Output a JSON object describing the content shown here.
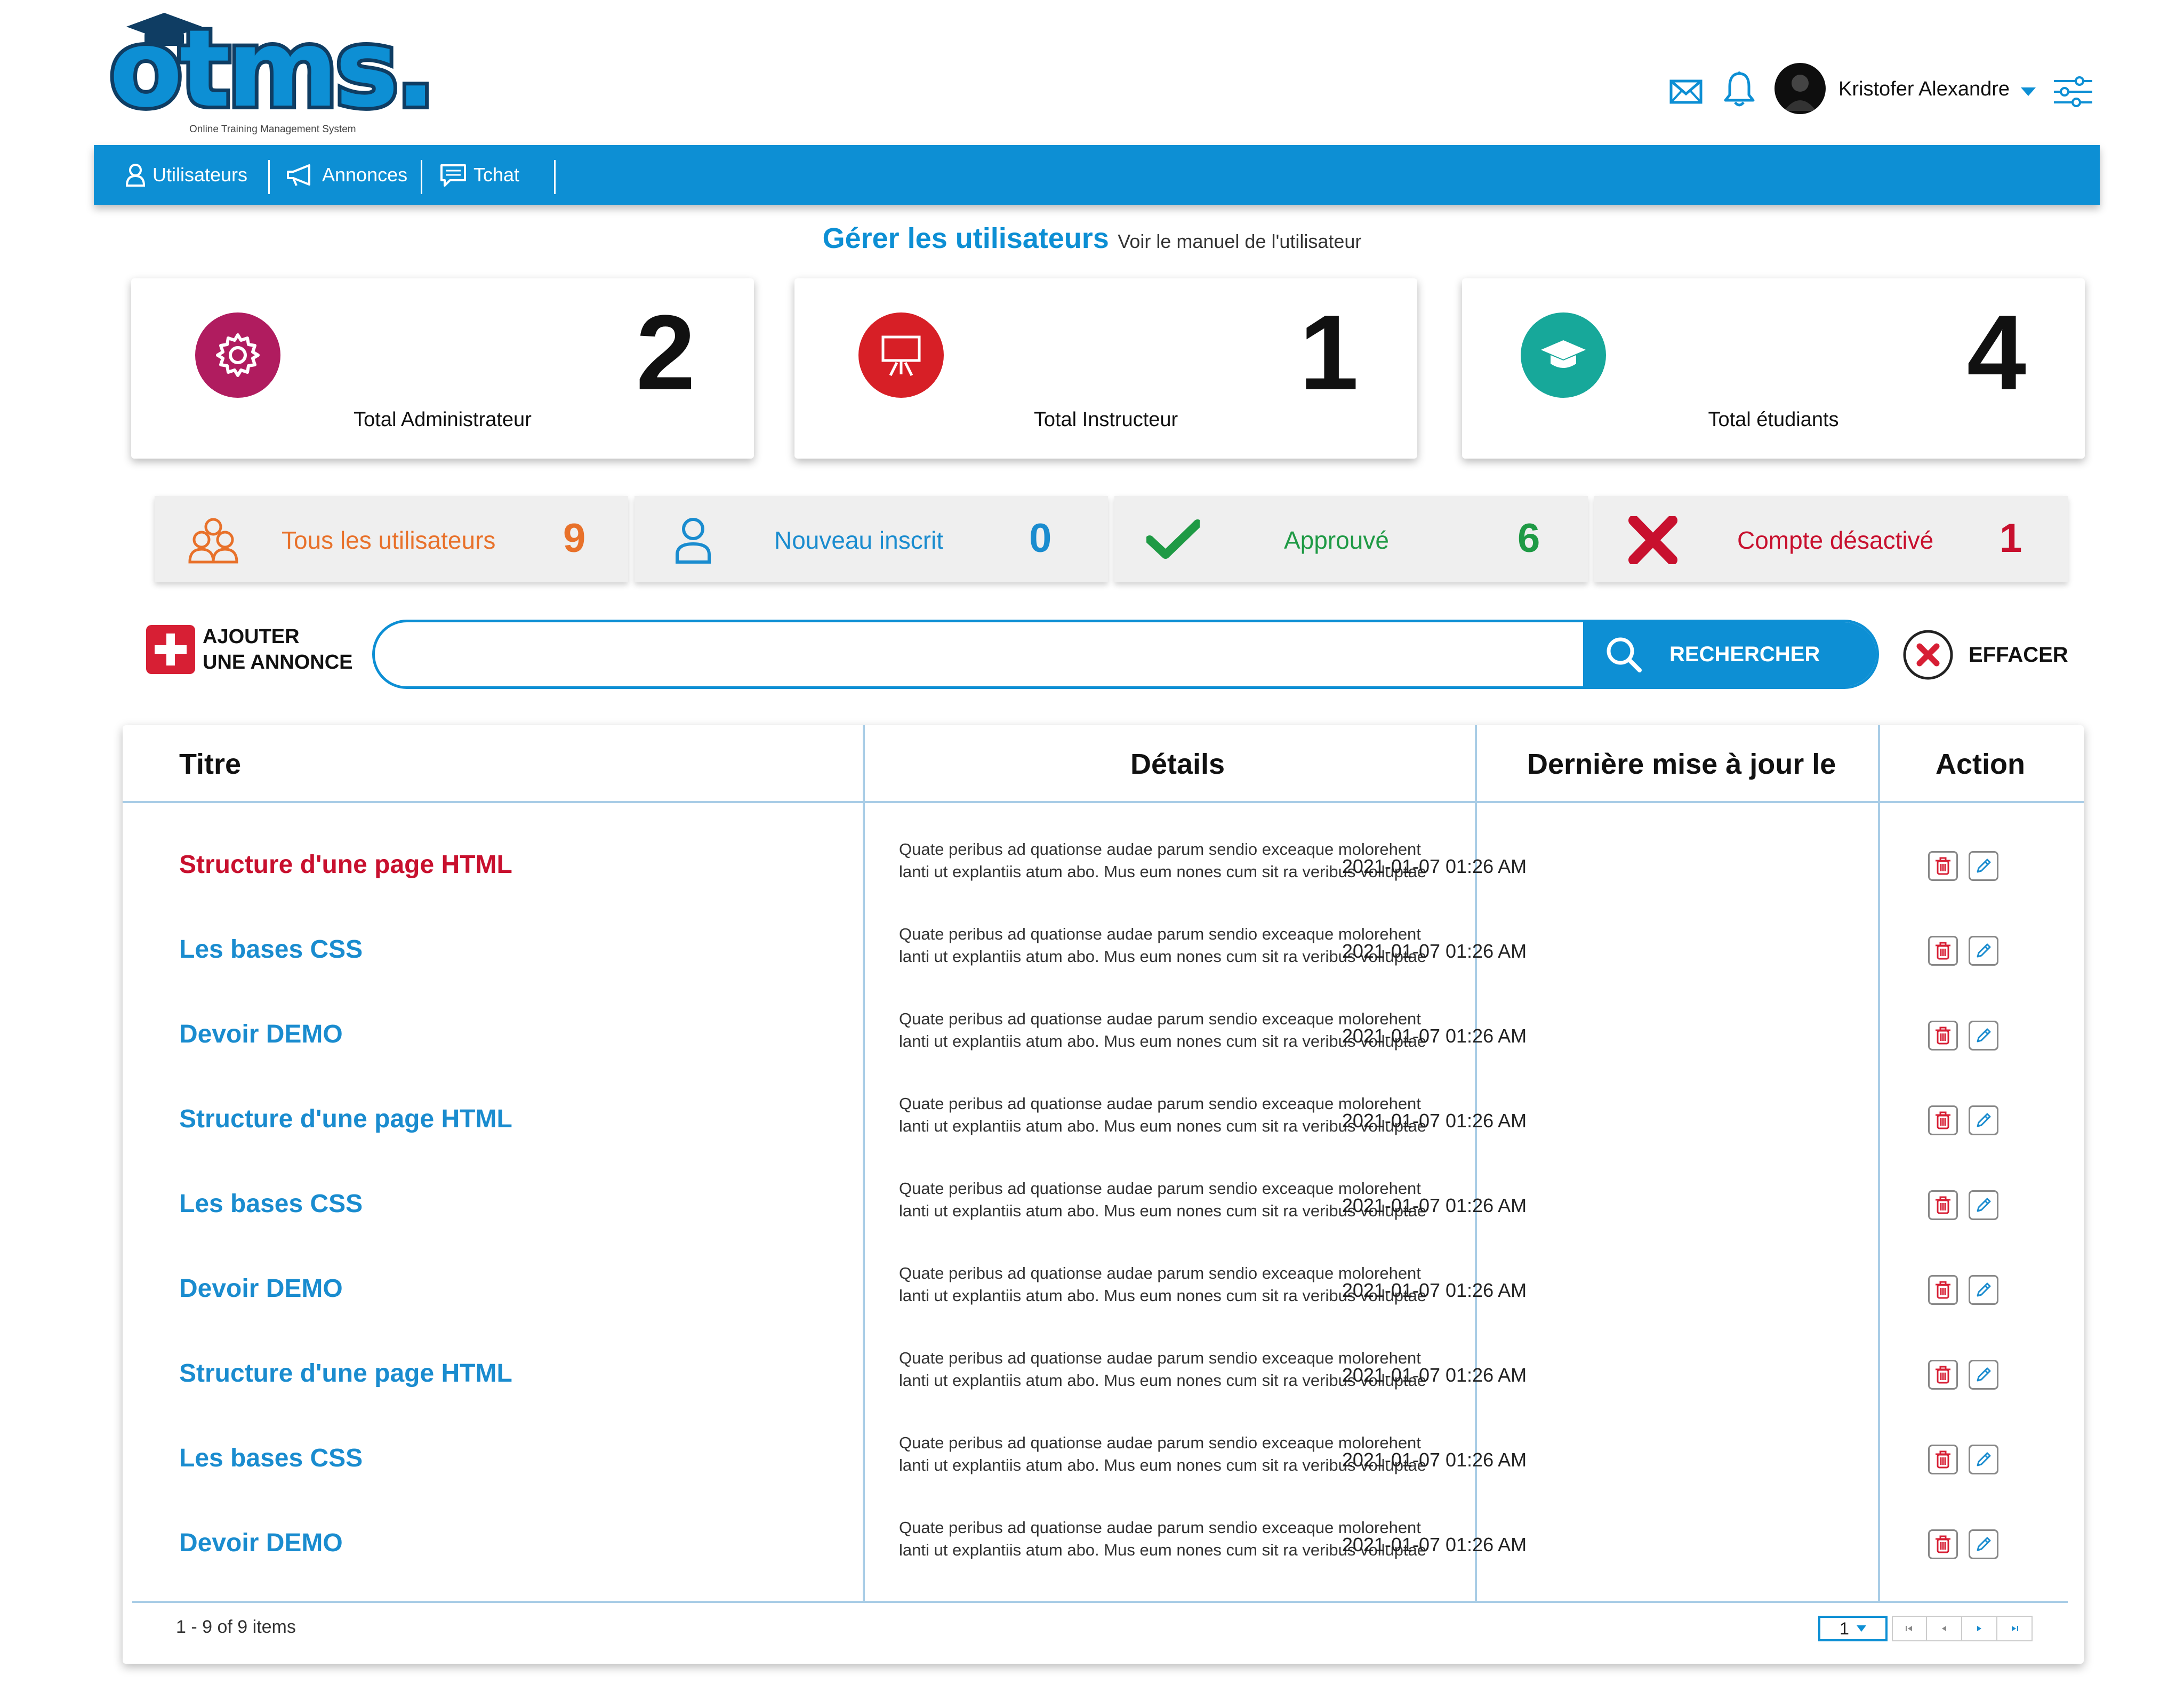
{
  "logo": {
    "text": "otms.",
    "subtitle": "Online Training Management System"
  },
  "user": {
    "name": "Kristofer Alexandre"
  },
  "nav": {
    "items": [
      {
        "label": "Utilisateurs"
      },
      {
        "label": "Annonces"
      },
      {
        "label": "Tchat"
      }
    ]
  },
  "page": {
    "title": "Gérer les utilisateurs",
    "manual_link": "Voir le manuel de l'utilisateur"
  },
  "stats": [
    {
      "label": "Total Administrateur",
      "value": "2",
      "color": "#b01c5f",
      "icon": "gear-icon"
    },
    {
      "label": "Total Instructeur",
      "value": "1",
      "color": "#d71f26",
      "icon": "presentation-board-icon"
    },
    {
      "label": "Total étudiants",
      "value": "4",
      "color": "#17a89a",
      "icon": "graduation-cap-icon"
    }
  ],
  "filters": [
    {
      "label": "Tous les utilisateurs",
      "count": "9",
      "color": "#e8712a",
      "icon": "users-group-icon"
    },
    {
      "label": "Nouveau inscrit",
      "count": "0",
      "color": "#1a8ccf",
      "icon": "user-icon"
    },
    {
      "label": "Approuvé",
      "count": "6",
      "color": "#1f9a45",
      "icon": "check-icon"
    },
    {
      "label": "Compte désactivé",
      "count": "1",
      "color": "#c8102e",
      "icon": "x-icon"
    }
  ],
  "actions": {
    "add_line1": "AJOUTER",
    "add_line2": "UNE ANNONCE",
    "search_placeholder": "",
    "search_value": "",
    "search_label": "RECHERCHER",
    "clear_label": "EFFACER"
  },
  "table": {
    "headers": {
      "title": "Titre",
      "details": "Détails",
      "date": "Dernière mise à jour le",
      "action": "Action"
    },
    "rows": [
      {
        "title": "Structure d'une page HTML",
        "details1": "Quate peribus ad quationse audae parum sendio exceaque molorehent",
        "details2": "lanti ut explantiis atum abo. Mus eum nones cum sit ra veribus volluptae",
        "date": "2021-01-07 01:26 AM"
      },
      {
        "title": "Les bases CSS",
        "details1": "Quate peribus ad quationse audae parum sendio exceaque molorehent",
        "details2": "lanti ut explantiis atum abo. Mus eum nones cum sit ra veribus volluptae",
        "date": "2021-01-07 01:26 AM"
      },
      {
        "title": "Devoir DEMO",
        "details1": "Quate peribus ad quationse audae parum sendio exceaque molorehent",
        "details2": "lanti ut explantiis atum abo. Mus eum nones cum sit ra veribus volluptae",
        "date": "2021-01-07 01:26 AM"
      },
      {
        "title": "Structure d'une page HTML",
        "details1": "Quate peribus ad quationse audae parum sendio exceaque molorehent",
        "details2": "lanti ut explantiis atum abo. Mus eum nones cum sit ra veribus volluptae",
        "date": "2021-01-07 01:26 AM"
      },
      {
        "title": "Les bases CSS",
        "details1": "Quate peribus ad quationse audae parum sendio exceaque molorehent",
        "details2": "lanti ut explantiis atum abo. Mus eum nones cum sit ra veribus volluptae",
        "date": "2021-01-07 01:26 AM"
      },
      {
        "title": "Devoir DEMO",
        "details1": "Quate peribus ad quationse audae parum sendio exceaque molorehent",
        "details2": "lanti ut explantiis atum abo. Mus eum nones cum sit ra veribus volluptae",
        "date": "2021-01-07 01:26 AM"
      },
      {
        "title": "Structure d'une page HTML",
        "details1": "Quate peribus ad quationse audae parum sendio exceaque molorehent",
        "details2": "lanti ut explantiis atum abo. Mus eum nones cum sit ra veribus volluptae",
        "date": "2021-01-07 01:26 AM"
      },
      {
        "title": "Les bases CSS",
        "details1": "Quate peribus ad quationse audae parum sendio exceaque molorehent",
        "details2": "lanti ut explantiis atum abo. Mus eum nones cum sit ra veribus volluptae",
        "date": "2021-01-07 01:26 AM"
      },
      {
        "title": "Devoir DEMO",
        "details1": "Quate peribus ad quationse audae parum sendio exceaque molorehent",
        "details2": "lanti ut explantiis atum abo. Mus eum nones cum sit ra veribus volluptae",
        "date": "2021-01-07 01:26 AM"
      }
    ],
    "items_count": "1 - 9 of 9 items",
    "current_page": "1"
  },
  "colors": {
    "brand": "#0d8fd4",
    "active_title": "#c8102e",
    "link": "#1a8ccf",
    "delete": "#d71f34"
  }
}
